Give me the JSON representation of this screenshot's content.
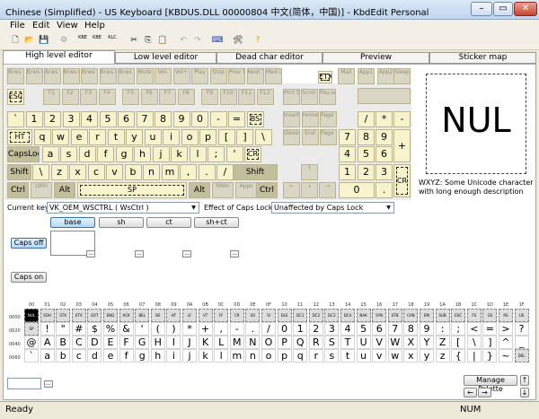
{
  "window": {
    "title": "Chinese (Simplified) - US Keyboard [KBDUS.DLL 00000804 中文(简体，中国)] - KbdEdit Personal",
    "min": "–",
    "max": "▭",
    "close": "✕"
  },
  "menu": [
    "File",
    "Edit",
    "View",
    "Help"
  ],
  "toolbar": {
    "btn1": "KBE",
    "btn2": "KBE",
    "btn3": "KLC"
  },
  "tabs": [
    "High level editor",
    "Low level editor",
    "Dead char editor",
    "Preview",
    "Sticker map"
  ],
  "keys": {
    "media": [
      "Brws Back",
      "Brws Forw",
      "Brws Stop",
      "Brws Refr",
      "Brws Srch",
      "Brws Fvrt",
      "Brws Home",
      "Mute",
      "Vol-",
      "Vol+",
      "Play",
      "Stop",
      "Prev Trck",
      "Next Trck",
      "Med ia"
    ],
    "mediarow2": [
      "Mail",
      "App1",
      "App2",
      "Sleep"
    ],
    "fn": [
      "ESC",
      "F1",
      "F2",
      "F3",
      "F4",
      "F5",
      "F6",
      "F7",
      "F8",
      "F9",
      "F10",
      "F11",
      "F12",
      "Prnt Scrn",
      "Scrol Lock",
      "Pau se"
    ],
    "num": [
      "`",
      "1",
      "2",
      "3",
      "4",
      "5",
      "6",
      "7",
      "8",
      "9",
      "0",
      "-",
      "=",
      "BS"
    ],
    "qwerty": [
      "HT",
      "q",
      "w",
      "e",
      "r",
      "t",
      "y",
      "u",
      "i",
      "o",
      "p",
      "[",
      "]",
      "\\"
    ],
    "home": [
      "CapsLock",
      "a",
      "s",
      "d",
      "f",
      "g",
      "h",
      "j",
      "k",
      "l",
      ";",
      "'",
      "CR"
    ],
    "shiftrow": [
      "Shift",
      "\\",
      "z",
      "x",
      "c",
      "v",
      "b",
      "n",
      "m",
      ",",
      ".",
      "/",
      "Shift"
    ],
    "bottom": [
      "Ctrl",
      "LWin",
      "Alt",
      "SP",
      "Alt",
      "RWin",
      "Apps",
      "Ctrl"
    ],
    "nav": [
      "Insert",
      "Home",
      "Page Up",
      "Delete",
      "End",
      "Page Down"
    ],
    "arrows": [
      "↑",
      "←",
      "↓",
      "→"
    ],
    "numpad": [
      "/",
      "*",
      "-",
      "7",
      "8",
      "9",
      "+",
      "4",
      "5",
      "6",
      "1",
      "2",
      "3",
      "CR",
      "0",
      "."
    ],
    "etx": "ETX"
  },
  "preview": {
    "char": "NUL",
    "desc": "WXYZ: Some Unicode character with long enough description"
  },
  "current_key": {
    "label": "Current key",
    "value": "VK_OEM_WSCTRL ( WsCtrl )"
  },
  "caps_effect": {
    "label": "Effect of Caps Lock",
    "value": "Unaffected by Caps Lock"
  },
  "shift_states": [
    "base",
    "sh",
    "ct",
    "sh+ct"
  ],
  "caps_off": "Caps off",
  "caps_on": "Caps on",
  "ellipsis": "...",
  "charmap": {
    "cols": [
      "00",
      "01",
      "02",
      "03",
      "04",
      "05",
      "06",
      "07",
      "08",
      "09",
      "0A",
      "0B",
      "0C",
      "0D",
      "0E",
      "0F",
      "10",
      "11",
      "12",
      "13",
      "14",
      "15",
      "16",
      "17",
      "18",
      "19",
      "1A",
      "1B",
      "1C",
      "1D",
      "1E",
      "1F"
    ],
    "rows": [
      "0000",
      "0020",
      "0040",
      "0060"
    ],
    "r0": [
      "NUL",
      "SOH",
      "STX",
      "ETX",
      "EOT",
      "ENQ",
      "ACK",
      "BEL",
      "BS",
      "HT",
      "LF",
      "VT",
      "FF",
      "CR",
      "SO",
      "SI",
      "DLE",
      "DC1",
      "DC2",
      "DC3",
      "DC4",
      "NAK",
      "SYN",
      "ETB",
      "CAN",
      "EM",
      "SUB",
      "ESC",
      "FS",
      "GS",
      "RS",
      "US"
    ],
    "r1": [
      "SP",
      "!",
      "\"",
      "#",
      "$",
      "%",
      "&",
      "'",
      "(",
      ")",
      "*",
      "+",
      ",",
      "-",
      ".",
      "/",
      "0",
      "1",
      "2",
      "3",
      "4",
      "5",
      "6",
      "7",
      "8",
      "9",
      ":",
      ";",
      "<",
      "=",
      ">",
      "?"
    ],
    "r2": [
      "@",
      "A",
      "B",
      "C",
      "D",
      "E",
      "F",
      "G",
      "H",
      "I",
      "J",
      "K",
      "L",
      "M",
      "N",
      "O",
      "P",
      "Q",
      "R",
      "S",
      "T",
      "U",
      "V",
      "W",
      "X",
      "Y",
      "Z",
      "[",
      "\\",
      "]",
      "^",
      "_"
    ],
    "r3": [
      "`",
      "a",
      "b",
      "c",
      "d",
      "e",
      "f",
      "g",
      "h",
      "i",
      "j",
      "k",
      "l",
      "m",
      "n",
      "o",
      "p",
      "q",
      "r",
      "s",
      "t",
      "u",
      "v",
      "w",
      "x",
      "y",
      "z",
      "{",
      "|",
      "}",
      "~",
      "DEL"
    ]
  },
  "manage_palette": "Manage Palette",
  "status": {
    "left": "Ready",
    "right": "NUM"
  }
}
